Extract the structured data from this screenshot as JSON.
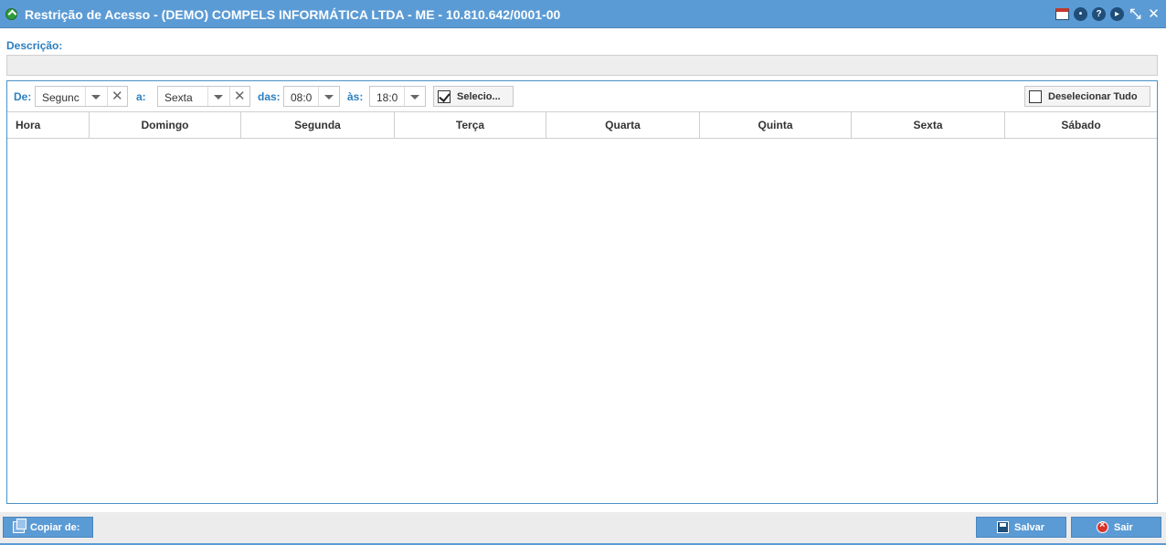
{
  "window": {
    "title": "Restrição de Acesso - (DEMO) COMPELS INFORMÁTICA LTDA - ME - 10.810.642/0001-00",
    "title_icon": "green-circle-up-icon",
    "tools": [
      {
        "name": "calendar-icon",
        "glyph": ""
      },
      {
        "name": "record-icon",
        "glyph": "•"
      },
      {
        "name": "help-icon",
        "glyph": "?"
      },
      {
        "name": "play-icon",
        "glyph": "▸"
      },
      {
        "name": "compress-icon",
        "glyph": "⤡"
      },
      {
        "name": "close-icon",
        "glyph": "✕"
      }
    ],
    "accent_color": "#5b9bd5"
  },
  "form": {
    "description_label": "Descrição:",
    "description_value": ""
  },
  "filters": {
    "from_label": "De:",
    "from_value": "Segunc",
    "to_label": "a:",
    "to_value": "Sexta",
    "start_label": "das:",
    "start_value": "08:0",
    "end_label": "às:",
    "end_value": "18:0",
    "select_label": "Selecio...",
    "select_checked": true,
    "deselect_label": "Deselecionar Tudo",
    "deselect_checked": false
  },
  "grid": {
    "columns": [
      "Hora",
      "Domingo",
      "Segunda",
      "Terça",
      "Quarta",
      "Quinta",
      "Sexta",
      "Sábado"
    ]
  },
  "footer": {
    "copy_label": "Copiar de:",
    "save_label": "Salvar",
    "exit_label": "Sair"
  }
}
